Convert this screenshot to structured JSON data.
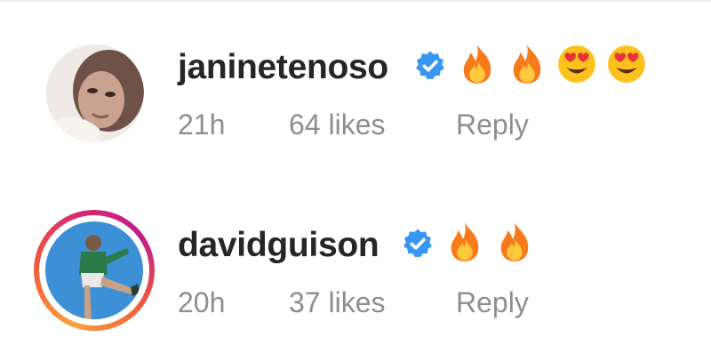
{
  "comments": [
    {
      "username": "janinetenoso",
      "emojis": [
        "fire-emoji",
        "fire-emoji",
        "heart-eyes-emoji",
        "heart-eyes-emoji"
      ],
      "time": "21h",
      "likes": "64 likes",
      "reply": "Reply",
      "has_story_ring": false
    },
    {
      "username": "davidguison",
      "emojis": [
        "fire-emoji",
        "fire-emoji"
      ],
      "time": "20h",
      "likes": "37 likes",
      "reply": "Reply",
      "has_story_ring": true
    }
  ],
  "colors": {
    "username": "#262626",
    "meta": "#8e8e8e",
    "verified": "#3897f0"
  }
}
